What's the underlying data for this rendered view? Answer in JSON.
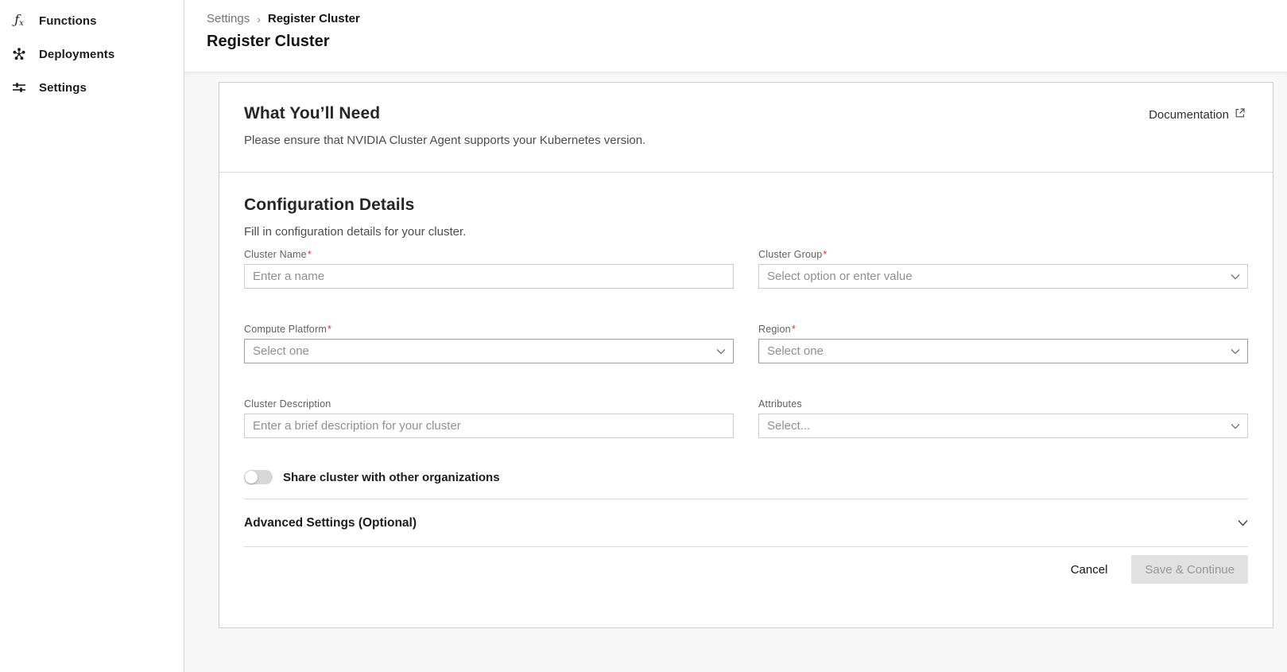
{
  "sidebar": {
    "items": [
      {
        "label": "Functions",
        "icon": "function-fx-icon"
      },
      {
        "label": "Deployments",
        "icon": "cluster-nodes-icon"
      },
      {
        "label": "Settings",
        "icon": "sliders-icon"
      }
    ]
  },
  "header": {
    "breadcrumb_parent": "Settings",
    "breadcrumb_separator": "›",
    "breadcrumb_current": "Register Cluster",
    "page_title": "Register Cluster"
  },
  "intro": {
    "title": "What You’ll Need",
    "description": "Please ensure that NVIDIA Cluster Agent supports your Kubernetes version.",
    "documentation_link": "Documentation",
    "documentation_icon": "external-link-icon"
  },
  "config": {
    "title": "Configuration Details",
    "subtitle": "Fill in configuration details for your cluster.",
    "fields": [
      {
        "label": "Cluster Name",
        "marker": "*",
        "placeholder": "Enter a name",
        "control": "text-input"
      },
      {
        "label": "Cluster Group",
        "marker": "*",
        "placeholder": "Select option or enter value",
        "control": "combobox"
      },
      {
        "label": "Compute Platform",
        "marker": "*",
        "placeholder": "Select one",
        "control": "select"
      },
      {
        "label": "Region",
        "marker": "*",
        "placeholder": "Select one",
        "control": "select"
      },
      {
        "label": "Cluster Description",
        "marker": "",
        "placeholder": "Enter a brief description for your cluster",
        "control": "text-input"
      },
      {
        "label": "Attributes",
        "marker": "",
        "placeholder": "Select...",
        "control": "select"
      }
    ],
    "share_toggle": {
      "label": "Share cluster with other organizations",
      "state": "off"
    },
    "advanced": {
      "label": "Advanced Settings (Optional)",
      "expanded": false
    }
  },
  "footer": {
    "cancel_label": "Cancel",
    "save_label": "Save & Continue",
    "save_disabled": true
  },
  "colors": {
    "required_marker": "#e0352b",
    "page_background": "#f7f7f7",
    "card_border": "#cccccc",
    "disabled_button_bg": "#e1e1e1"
  }
}
